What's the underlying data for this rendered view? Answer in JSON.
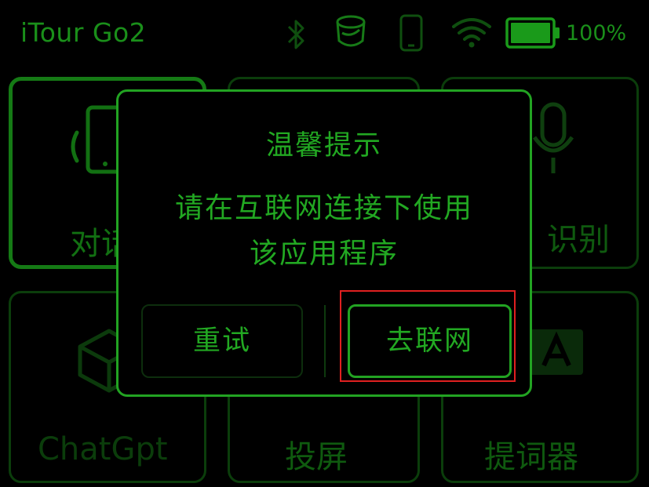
{
  "status_bar": {
    "app_title": "iTour Go2",
    "battery_text": "100%",
    "icons": [
      "bluetooth-icon",
      "watch-icon",
      "phone-icon",
      "wifi-icon",
      "battery-icon"
    ]
  },
  "tiles": [
    {
      "label": "对话",
      "icon": "phone-sound-icon",
      "active": true
    },
    {
      "label": "",
      "icon": "",
      "active": false
    },
    {
      "label": "识别",
      "icon": "microphone-icon",
      "active": false
    },
    {
      "label": "ChatGpt",
      "icon": "cube-icon",
      "active": false
    },
    {
      "label": "投屏",
      "icon": "",
      "active": false
    },
    {
      "label": "提词器",
      "icon": "text-a-icon",
      "active": false
    }
  ],
  "dialog": {
    "title": "温馨提示",
    "message_line1": "请在互联网连接下使用",
    "message_line2": "该应用程序",
    "retry_label": "重试",
    "network_label": "去联网"
  },
  "colors": {
    "accent": "#22a822",
    "dim": "#0f5a0f",
    "background": "#000000",
    "highlight": "#e02020"
  }
}
